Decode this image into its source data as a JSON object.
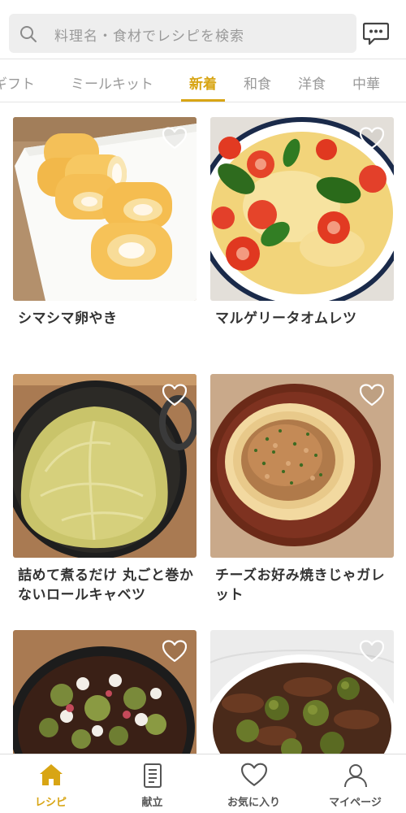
{
  "search": {
    "placeholder": "料理名・食材でレシピを検索",
    "icon": "search-icon",
    "chat_icon": "chat-icon"
  },
  "tabs": [
    {
      "label": "ギフト",
      "active": false
    },
    {
      "label": "ミールキット",
      "active": false
    },
    {
      "label": "新着",
      "active": true
    },
    {
      "label": "和食",
      "active": false
    },
    {
      "label": "洋食",
      "active": false
    },
    {
      "label": "中華",
      "active": false
    }
  ],
  "recipes": [
    {
      "title": "シマシマ卵やき",
      "favorite": false
    },
    {
      "title": "マルゲリータオムレツ",
      "favorite": false
    },
    {
      "title": "詰めて煮るだけ 丸ごと巻かないロールキャベツ",
      "favorite": false
    },
    {
      "title": "チーズお好み焼きじゃガレット",
      "favorite": false
    },
    {
      "title": "",
      "favorite": false
    },
    {
      "title": "",
      "favorite": false
    }
  ],
  "bottom_nav": [
    {
      "label": "レシピ",
      "icon": "home-icon",
      "active": true
    },
    {
      "label": "献立",
      "icon": "menu-notebook-icon",
      "active": false
    },
    {
      "label": "お気に入り",
      "icon": "heart-icon",
      "active": false
    },
    {
      "label": "マイページ",
      "icon": "person-icon",
      "active": false
    }
  ],
  "colors": {
    "accent": "#d8a514",
    "inactive": "#9a9a9a",
    "search_bg": "#eeeeee"
  }
}
